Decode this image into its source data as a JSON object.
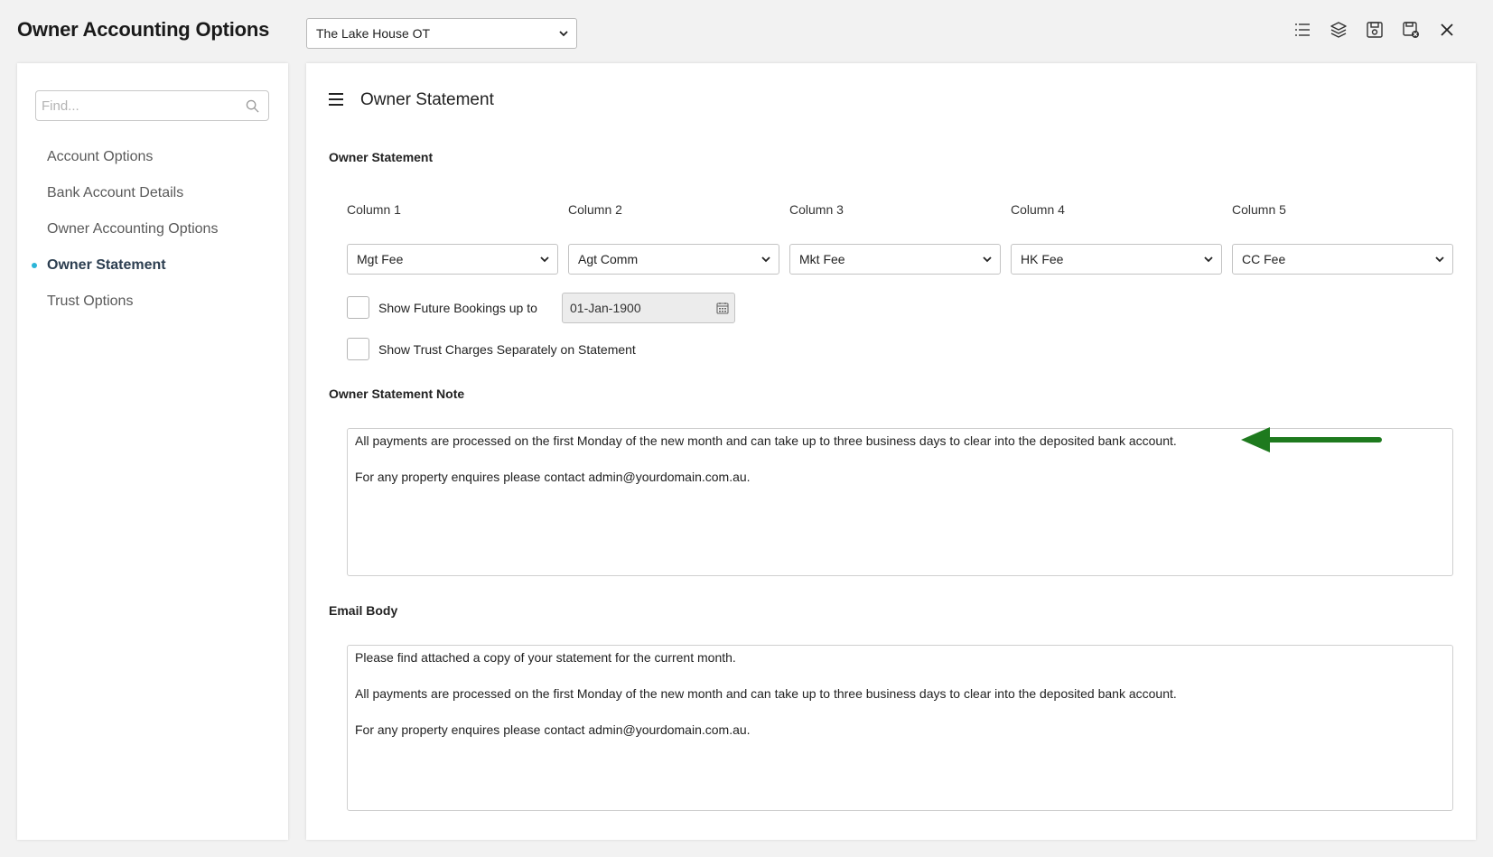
{
  "app": {
    "title": "Owner Accounting Options",
    "property_selected": "The Lake House OT"
  },
  "toolbar": {
    "icons": [
      "list-icon",
      "layers-icon",
      "save-icon",
      "save-close-icon",
      "close-icon"
    ]
  },
  "sidebar": {
    "search_placeholder": "Find...",
    "items": [
      {
        "label": "Account Options",
        "active": false
      },
      {
        "label": "Bank Account Details",
        "active": false
      },
      {
        "label": "Owner Accounting Options",
        "active": false
      },
      {
        "label": "Owner Statement",
        "active": true
      },
      {
        "label": "Trust Options",
        "active": false
      }
    ]
  },
  "main": {
    "title": "Owner Statement",
    "section_statement": "Owner Statement",
    "columns": [
      {
        "label": "Column 1",
        "value": "Mgt Fee"
      },
      {
        "label": "Column 2",
        "value": "Agt Comm"
      },
      {
        "label": "Column 3",
        "value": "Mkt Fee"
      },
      {
        "label": "Column 4",
        "value": "HK Fee"
      },
      {
        "label": "Column 5",
        "value": "CC Fee"
      }
    ],
    "future_bookings": {
      "label": "Show Future Bookings up to",
      "checked": false,
      "date": "01-Jan-1900"
    },
    "trust_charges": {
      "label": "Show Trust Charges Separately on Statement",
      "checked": false
    },
    "section_note": "Owner Statement Note",
    "note_lines": [
      "All payments are processed on the first Monday of the new month and can take up to three business days to clear into the deposited bank account.",
      "For any property enquires please contact admin@yourdomain.com.au."
    ],
    "section_email": "Email Body",
    "email_lines": [
      "Please find attached a copy of your statement for the current month.",
      "All payments are processed on the first Monday of the new month and can take up to three business days to clear into the deposited bank account.",
      "For any property enquires please contact admin@yourdomain.com.au."
    ]
  },
  "colors": {
    "active_dot": "#2bb5d8",
    "annotation_arrow": "#1e7a1e"
  }
}
